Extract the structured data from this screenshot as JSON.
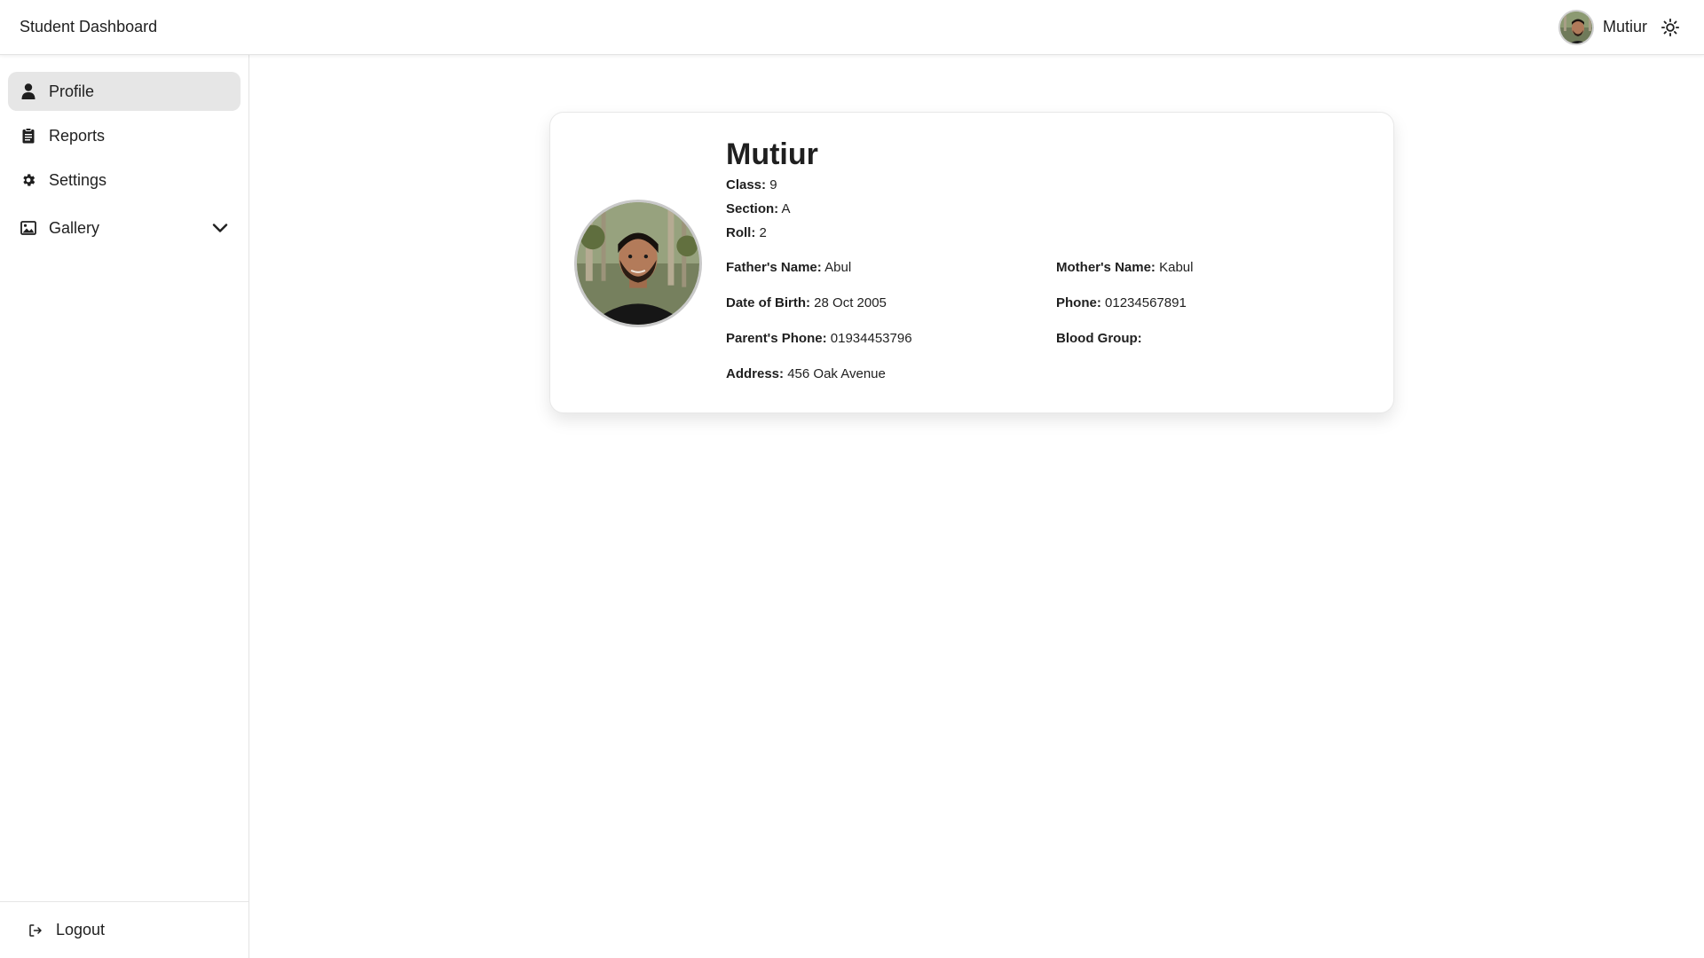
{
  "app": {
    "title": "Student Dashboard"
  },
  "header": {
    "username": "Mutiur",
    "theme_icon": "sun-icon"
  },
  "sidebar": {
    "items": [
      {
        "label": "Profile",
        "icon": "user-icon",
        "active": true
      },
      {
        "label": "Reports",
        "icon": "clipboard-icon",
        "active": false
      },
      {
        "label": "Settings",
        "icon": "gear-icon",
        "active": false
      },
      {
        "label": "Gallery",
        "icon": "image-icon",
        "active": false,
        "expandable": true
      }
    ],
    "logout_label": "Logout"
  },
  "profile": {
    "name": "Mutiur",
    "class_label": "Class:",
    "class_value": "9",
    "section_label": "Section:",
    "section_value": "A",
    "roll_label": "Roll:",
    "roll_value": "2",
    "father_label": "Father's Name:",
    "father_value": "Abul",
    "mother_label": "Mother's Name:",
    "mother_value": "Kabul",
    "dob_label": "Date of Birth:",
    "dob_value": "28 Oct 2005",
    "phone_label": "Phone:",
    "phone_value": "01234567891",
    "parent_phone_label": "Parent's Phone:",
    "parent_phone_value": "01934453796",
    "blood_label": "Blood Group:",
    "blood_value": "",
    "address_label": "Address:",
    "address_value": "456 Oak Avenue"
  },
  "colors": {
    "active_nav_bg": "#e6e6e6",
    "text": "#1f1f1f",
    "border": "#e3e3e3"
  }
}
